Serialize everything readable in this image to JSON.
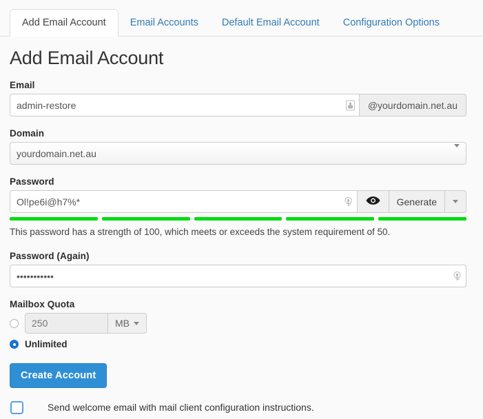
{
  "tabs": [
    {
      "label": "Add Email Account",
      "active": true
    },
    {
      "label": "Email Accounts",
      "active": false
    },
    {
      "label": "Default Email Account",
      "active": false
    },
    {
      "label": "Configuration Options",
      "active": false
    }
  ],
  "page": {
    "title": "Add Email Account"
  },
  "email": {
    "label": "Email",
    "value": "admin-restore",
    "placeholder": "",
    "suffix": "@yourdomain.net.au",
    "manager_icon": "password-manager-icon"
  },
  "domain": {
    "label": "Domain",
    "selected": "yourdomain.net.au",
    "options": [
      "yourdomain.net.au"
    ],
    "caret_icon": "chevron-down-icon"
  },
  "password": {
    "label": "Password",
    "value": "Ol!pe6i@h7%*",
    "manager_icon": "password-manager-icon",
    "eye_icon": "eye-icon",
    "generate_label": "Generate",
    "caret_icon": "chevron-down-icon",
    "strength_message": "This password has a strength of 100, which meets or exceeds the system requirement of 50.",
    "strength_value": 100,
    "strength_requirement": 50,
    "strength_segments": 5,
    "strength_color": "#00dd11"
  },
  "password_again": {
    "label": "Password (Again)",
    "value": "•••••••••••",
    "manager_icon": "password-manager-icon"
  },
  "quota": {
    "label": "Mailbox Quota",
    "value": "250",
    "unit": "MB",
    "unit_caret_icon": "chevron-down-icon",
    "limited_selected": false,
    "unlimited_label": "Unlimited",
    "unlimited_selected": true
  },
  "actions": {
    "create_label": "Create Account",
    "create_color": "#2f8fd4",
    "welcome_label": "Send welcome email with mail client configuration instructions.",
    "welcome_checked": false
  }
}
